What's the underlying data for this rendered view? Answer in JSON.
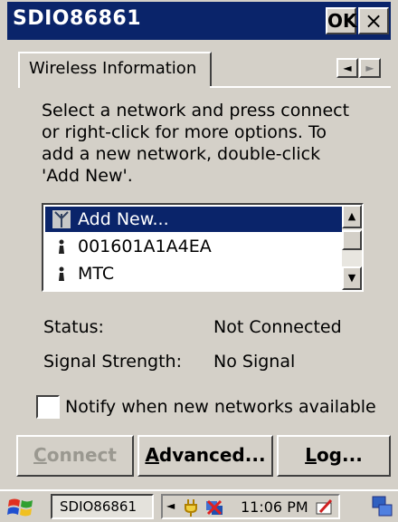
{
  "window": {
    "title": "SDIO86861",
    "ok_label": "OK",
    "close_label": "×"
  },
  "tabs": [
    {
      "label": "Wireless Information",
      "selected": true
    }
  ],
  "tab_scroll": {
    "left": "◄",
    "right": "►"
  },
  "instructions": "Select a network and press connect\nor right-click for more options.  To\nadd a new network, double-click\n'Add New'.",
  "networks": {
    "items": [
      {
        "label": "Add New...",
        "icon": "antenna-icon",
        "selected": true
      },
      {
        "label": "001601A1A4EA",
        "icon": "access-point-icon",
        "selected": false
      },
      {
        "label": "MTC",
        "icon": "access-point-icon",
        "selected": false
      }
    ],
    "scroll_up": "▲",
    "scroll_down": "▼"
  },
  "status": {
    "status_label": "Status:",
    "status_value": "Not Connected",
    "signal_label": "Signal Strength:",
    "signal_value": "No Signal"
  },
  "notify": {
    "label": "Notify when new networks available",
    "checked": false
  },
  "buttons": {
    "connect": {
      "first": "C",
      "rest": "onnect",
      "enabled": false
    },
    "advanced": {
      "first": "A",
      "rest": "dvanced..."
    },
    "log": {
      "first": "L",
      "rest": "og..."
    }
  },
  "taskbar": {
    "task_label": "SDIO86861",
    "tray_arrow": "◄",
    "clock": "11:06 PM"
  },
  "colors": {
    "titlebar": "#0a246a",
    "face": "#d4d0c8",
    "selection": "#0a246a"
  }
}
